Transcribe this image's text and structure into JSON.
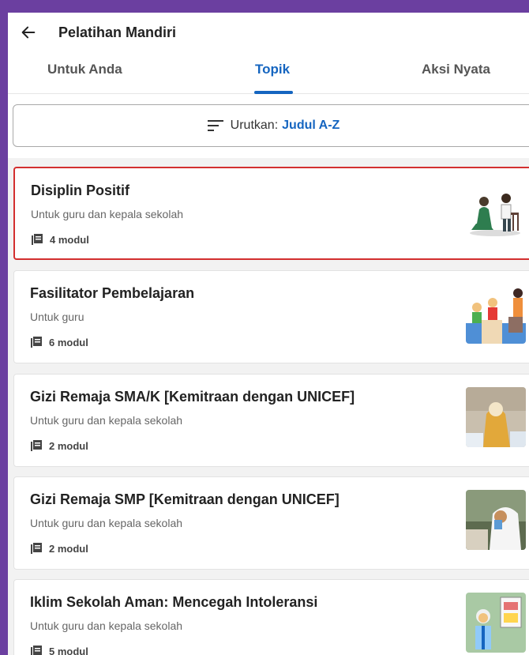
{
  "header": {
    "title": "Pelatihan Mandiri",
    "back_icon": "arrow-left-icon"
  },
  "tabs": [
    {
      "label": "Untuk Anda",
      "active": false
    },
    {
      "label": "Topik",
      "active": true
    },
    {
      "label": "Aksi Nyata",
      "active": false
    }
  ],
  "sort": {
    "label": "Urutkan:",
    "value": "Judul A-Z",
    "icon": "sort-icon"
  },
  "colors": {
    "accent": "#1565c0",
    "highlight": "#d32f2f",
    "frame": "#6b3fa0"
  },
  "courses": [
    {
      "title": "Disiplin Positif",
      "audience": "Untuk guru dan kepala sekolah",
      "modules": "4 modul",
      "highlighted": true
    },
    {
      "title": "Fasilitator Pembelajaran",
      "audience": "Untuk guru",
      "modules": "6 modul",
      "highlighted": false
    },
    {
      "title": "Gizi Remaja SMA/K [Kemitraan dengan UNICEF]",
      "audience": "Untuk guru dan kepala sekolah",
      "modules": "2 modul",
      "highlighted": false
    },
    {
      "title": "Gizi Remaja SMP [Kemitraan dengan UNICEF]",
      "audience": "Untuk guru dan kepala sekolah",
      "modules": "2 modul",
      "highlighted": false
    },
    {
      "title": "Iklim Sekolah Aman: Mencegah Intoleransi",
      "audience": "Untuk guru dan kepala sekolah",
      "modules": "5 modul",
      "highlighted": false
    }
  ]
}
